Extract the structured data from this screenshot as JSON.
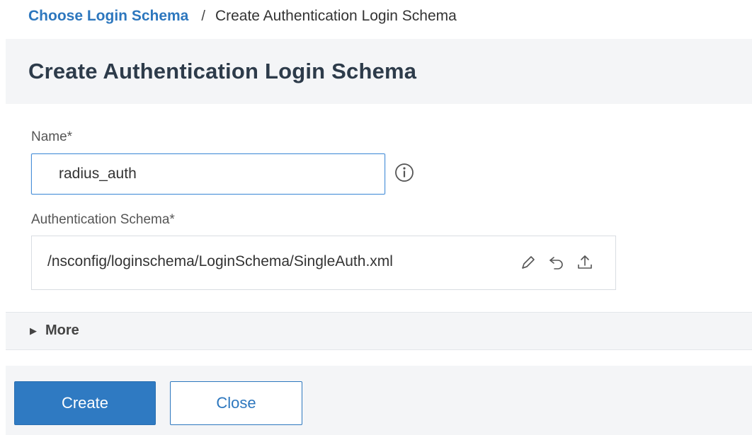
{
  "breadcrumb": {
    "parent": "Choose Login Schema",
    "separator": "/",
    "current": "Create Authentication Login Schema"
  },
  "page_title": "Create Authentication Login Schema",
  "form": {
    "name": {
      "label": "Name*",
      "value": "radius_auth"
    },
    "authentication_schema": {
      "label": "Authentication Schema*",
      "value": "/nsconfig/loginschema/LoginSchema/SingleAuth.xml",
      "actions": [
        "edit-icon",
        "revert-icon",
        "upload-icon"
      ]
    }
  },
  "more": {
    "label": "More"
  },
  "footer": {
    "create_label": "Create",
    "close_label": "Close"
  },
  "colors": {
    "accent": "#2d77be",
    "primary_button": "#2f7ac2",
    "panel_background": "#f4f5f7"
  }
}
